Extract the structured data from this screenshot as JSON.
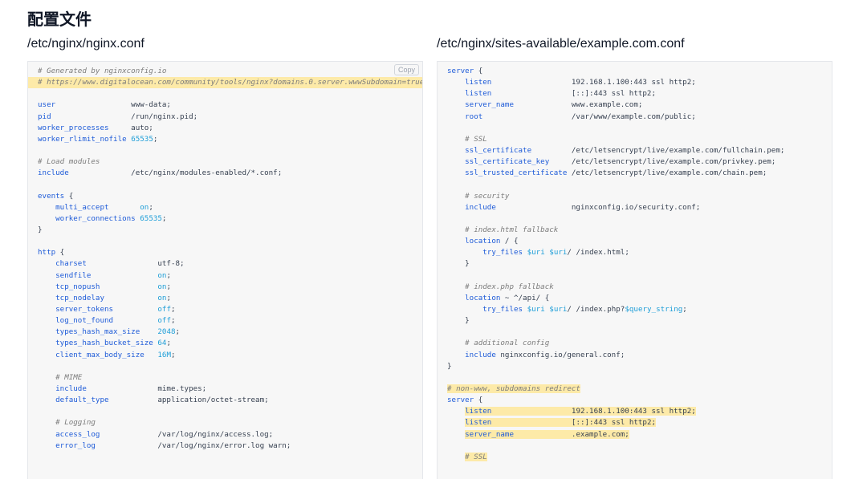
{
  "page": {
    "title": "配置文件"
  },
  "left_panel": {
    "path": "/etc/nginx/nginx.conf",
    "copy_label": "Copy",
    "lines": [
      {
        "hl": false,
        "parts": [
          {
            "t": "# Generated by nginxconfig.io",
            "c": "cm"
          }
        ]
      },
      {
        "hl": true,
        "parts": [
          {
            "t": "# https://www.digitalocean.com/community/tools/nginx?domains.0.server.wwwSubdomain=true",
            "c": "cm"
          }
        ]
      },
      {
        "hl": false,
        "parts": []
      },
      {
        "hl": false,
        "parts": [
          {
            "t": "user",
            "c": "kw"
          },
          {
            "t": "                 www-data;",
            "c": ""
          }
        ]
      },
      {
        "hl": false,
        "parts": [
          {
            "t": "pid",
            "c": "kw"
          },
          {
            "t": "                  /run/nginx.pid;",
            "c": ""
          }
        ]
      },
      {
        "hl": false,
        "parts": [
          {
            "t": "worker_processes",
            "c": "kw"
          },
          {
            "t": "     auto;",
            "c": ""
          }
        ]
      },
      {
        "hl": false,
        "parts": [
          {
            "t": "worker_rlimit_nofile",
            "c": "kw"
          },
          {
            "t": " ",
            "c": ""
          },
          {
            "t": "65535",
            "c": "num"
          },
          {
            "t": ";",
            "c": ""
          }
        ]
      },
      {
        "hl": false,
        "parts": []
      },
      {
        "hl": false,
        "parts": [
          {
            "t": "# Load modules",
            "c": "cm"
          }
        ]
      },
      {
        "hl": false,
        "parts": [
          {
            "t": "include",
            "c": "kw"
          },
          {
            "t": "              /etc/nginx/modules-enabled/*.conf;",
            "c": ""
          }
        ]
      },
      {
        "hl": false,
        "parts": []
      },
      {
        "hl": false,
        "parts": [
          {
            "t": "events",
            "c": "kw"
          },
          {
            "t": " {",
            "c": ""
          }
        ]
      },
      {
        "hl": false,
        "parts": [
          {
            "t": "    multi_accept",
            "c": "kw"
          },
          {
            "t": "       ",
            "c": ""
          },
          {
            "t": "on",
            "c": "num"
          },
          {
            "t": ";",
            "c": ""
          }
        ]
      },
      {
        "hl": false,
        "parts": [
          {
            "t": "    worker_connections",
            "c": "kw"
          },
          {
            "t": " ",
            "c": ""
          },
          {
            "t": "65535",
            "c": "num"
          },
          {
            "t": ";",
            "c": ""
          }
        ]
      },
      {
        "hl": false,
        "parts": [
          {
            "t": "}",
            "c": ""
          }
        ]
      },
      {
        "hl": false,
        "parts": []
      },
      {
        "hl": false,
        "parts": [
          {
            "t": "http",
            "c": "kw"
          },
          {
            "t": " {",
            "c": ""
          }
        ]
      },
      {
        "hl": false,
        "parts": [
          {
            "t": "    charset",
            "c": "kw"
          },
          {
            "t": "                utf-8;",
            "c": ""
          }
        ]
      },
      {
        "hl": false,
        "parts": [
          {
            "t": "    sendfile",
            "c": "kw"
          },
          {
            "t": "               ",
            "c": ""
          },
          {
            "t": "on",
            "c": "num"
          },
          {
            "t": ";",
            "c": ""
          }
        ]
      },
      {
        "hl": false,
        "parts": [
          {
            "t": "    tcp_nopush",
            "c": "kw"
          },
          {
            "t": "             ",
            "c": ""
          },
          {
            "t": "on",
            "c": "num"
          },
          {
            "t": ";",
            "c": ""
          }
        ]
      },
      {
        "hl": false,
        "parts": [
          {
            "t": "    tcp_nodelay",
            "c": "kw"
          },
          {
            "t": "            ",
            "c": ""
          },
          {
            "t": "on",
            "c": "num"
          },
          {
            "t": ";",
            "c": ""
          }
        ]
      },
      {
        "hl": false,
        "parts": [
          {
            "t": "    server_tokens",
            "c": "kw"
          },
          {
            "t": "          ",
            "c": ""
          },
          {
            "t": "off",
            "c": "num"
          },
          {
            "t": ";",
            "c": ""
          }
        ]
      },
      {
        "hl": false,
        "parts": [
          {
            "t": "    log_not_found",
            "c": "kw"
          },
          {
            "t": "          ",
            "c": ""
          },
          {
            "t": "off",
            "c": "num"
          },
          {
            "t": ";",
            "c": ""
          }
        ]
      },
      {
        "hl": false,
        "parts": [
          {
            "t": "    types_hash_max_size",
            "c": "kw"
          },
          {
            "t": "    ",
            "c": ""
          },
          {
            "t": "2048",
            "c": "num"
          },
          {
            "t": ";",
            "c": ""
          }
        ]
      },
      {
        "hl": false,
        "parts": [
          {
            "t": "    types_hash_bucket_size",
            "c": "kw"
          },
          {
            "t": " ",
            "c": ""
          },
          {
            "t": "64",
            "c": "num"
          },
          {
            "t": ";",
            "c": ""
          }
        ]
      },
      {
        "hl": false,
        "parts": [
          {
            "t": "    client_max_body_size",
            "c": "kw"
          },
          {
            "t": "   ",
            "c": ""
          },
          {
            "t": "16M",
            "c": "num"
          },
          {
            "t": ";",
            "c": ""
          }
        ]
      },
      {
        "hl": false,
        "parts": []
      },
      {
        "hl": false,
        "parts": [
          {
            "t": "    # MIME",
            "c": "cm"
          }
        ]
      },
      {
        "hl": false,
        "parts": [
          {
            "t": "    include",
            "c": "kw"
          },
          {
            "t": "                mime.types;",
            "c": ""
          }
        ]
      },
      {
        "hl": false,
        "parts": [
          {
            "t": "    default_type",
            "c": "kw"
          },
          {
            "t": "           application/octet-stream;",
            "c": ""
          }
        ]
      },
      {
        "hl": false,
        "parts": []
      },
      {
        "hl": false,
        "parts": [
          {
            "t": "    # Logging",
            "c": "cm"
          }
        ]
      },
      {
        "hl": false,
        "parts": [
          {
            "t": "    access_log",
            "c": "kw"
          },
          {
            "t": "             /var/log/nginx/access.log;",
            "c": ""
          }
        ]
      },
      {
        "hl": false,
        "parts": [
          {
            "t": "    error_log",
            "c": "kw"
          },
          {
            "t": "              /var/log/nginx/error.log warn;",
            "c": ""
          }
        ]
      }
    ]
  },
  "right_panel": {
    "path": "/etc/nginx/sites-available/example.com.conf",
    "lines": [
      {
        "hl": false,
        "parts": [
          {
            "t": "server",
            "c": "kw"
          },
          {
            "t": " {",
            "c": ""
          }
        ]
      },
      {
        "hl": false,
        "parts": [
          {
            "t": "    listen",
            "c": "kw"
          },
          {
            "t": "                  192.168.1.100:443 ssl http2;",
            "c": ""
          }
        ]
      },
      {
        "hl": false,
        "parts": [
          {
            "t": "    listen",
            "c": "kw"
          },
          {
            "t": "                  [::]:443 ssl http2;",
            "c": ""
          }
        ]
      },
      {
        "hl": false,
        "parts": [
          {
            "t": "    server_name",
            "c": "kw"
          },
          {
            "t": "             www.example.com;",
            "c": ""
          }
        ]
      },
      {
        "hl": false,
        "parts": [
          {
            "t": "    root",
            "c": "kw"
          },
          {
            "t": "                    /var/www/example.com/public;",
            "c": ""
          }
        ]
      },
      {
        "hl": false,
        "parts": []
      },
      {
        "hl": false,
        "parts": [
          {
            "t": "    # SSL",
            "c": "cm"
          }
        ]
      },
      {
        "hl": false,
        "parts": [
          {
            "t": "    ssl_certificate",
            "c": "kw"
          },
          {
            "t": "         /etc/letsencrypt/live/example.com/fullchain.pem;",
            "c": ""
          }
        ]
      },
      {
        "hl": false,
        "parts": [
          {
            "t": "    ssl_certificate_key",
            "c": "kw"
          },
          {
            "t": "     /etc/letsencrypt/live/example.com/privkey.pem;",
            "c": ""
          }
        ]
      },
      {
        "hl": false,
        "parts": [
          {
            "t": "    ssl_trusted_certificate",
            "c": "kw"
          },
          {
            "t": " /etc/letsencrypt/live/example.com/chain.pem;",
            "c": ""
          }
        ]
      },
      {
        "hl": false,
        "parts": []
      },
      {
        "hl": false,
        "parts": [
          {
            "t": "    # security",
            "c": "cm"
          }
        ]
      },
      {
        "hl": false,
        "parts": [
          {
            "t": "    include",
            "c": "kw"
          },
          {
            "t": "                 nginxconfig.io/security.conf;",
            "c": ""
          }
        ]
      },
      {
        "hl": false,
        "parts": []
      },
      {
        "hl": false,
        "parts": [
          {
            "t": "    # index.html fallback",
            "c": "cm"
          }
        ]
      },
      {
        "hl": false,
        "parts": [
          {
            "t": "    location",
            "c": "kw"
          },
          {
            "t": " / {",
            "c": ""
          }
        ]
      },
      {
        "hl": false,
        "parts": [
          {
            "t": "        try_files",
            "c": "kw"
          },
          {
            "t": " ",
            "c": ""
          },
          {
            "t": "$uri",
            "c": "var"
          },
          {
            "t": " ",
            "c": ""
          },
          {
            "t": "$uri",
            "c": "var"
          },
          {
            "t": "/ /index.html;",
            "c": ""
          }
        ]
      },
      {
        "hl": false,
        "parts": [
          {
            "t": "    }",
            "c": ""
          }
        ]
      },
      {
        "hl": false,
        "parts": []
      },
      {
        "hl": false,
        "parts": [
          {
            "t": "    # index.php fallback",
            "c": "cm"
          }
        ]
      },
      {
        "hl": false,
        "parts": [
          {
            "t": "    location",
            "c": "kw"
          },
          {
            "t": " ~ ^/api/ {",
            "c": ""
          }
        ]
      },
      {
        "hl": false,
        "parts": [
          {
            "t": "        try_files",
            "c": "kw"
          },
          {
            "t": " ",
            "c": ""
          },
          {
            "t": "$uri",
            "c": "var"
          },
          {
            "t": " ",
            "c": ""
          },
          {
            "t": "$uri",
            "c": "var"
          },
          {
            "t": "/ /index.php?",
            "c": ""
          },
          {
            "t": "$query_string",
            "c": "var"
          },
          {
            "t": ";",
            "c": ""
          }
        ]
      },
      {
        "hl": false,
        "parts": [
          {
            "t": "    }",
            "c": ""
          }
        ]
      },
      {
        "hl": false,
        "parts": []
      },
      {
        "hl": false,
        "parts": [
          {
            "t": "    # additional config",
            "c": "cm"
          }
        ]
      },
      {
        "hl": false,
        "parts": [
          {
            "t": "    include",
            "c": "kw"
          },
          {
            "t": " nginxconfig.io/general.conf;",
            "c": ""
          }
        ]
      },
      {
        "hl": false,
        "parts": [
          {
            "t": "}",
            "c": ""
          }
        ]
      },
      {
        "hl": false,
        "parts": []
      },
      {
        "hl": "inline",
        "parts": [
          {
            "t": "# non-www, subdomains redirect",
            "c": "cm"
          }
        ]
      },
      {
        "hl": false,
        "parts": [
          {
            "t": "server",
            "c": "kw"
          },
          {
            "t": " {",
            "c": ""
          }
        ]
      },
      {
        "hl": "inline-indent",
        "parts": [
          {
            "t": "listen",
            "c": "kw"
          },
          {
            "t": "                  192.168.1.100:443 ssl http2;",
            "c": ""
          }
        ]
      },
      {
        "hl": "inline-indent",
        "parts": [
          {
            "t": "listen",
            "c": "kw"
          },
          {
            "t": "                  [::]:443 ssl http2;",
            "c": ""
          }
        ]
      },
      {
        "hl": "inline-indent",
        "parts": [
          {
            "t": "server_name",
            "c": "kw"
          },
          {
            "t": "             .example.com;",
            "c": ""
          }
        ]
      },
      {
        "hl": false,
        "parts": []
      },
      {
        "hl": "inline-indent",
        "parts": [
          {
            "t": "# SSL",
            "c": "cm"
          }
        ]
      }
    ]
  }
}
